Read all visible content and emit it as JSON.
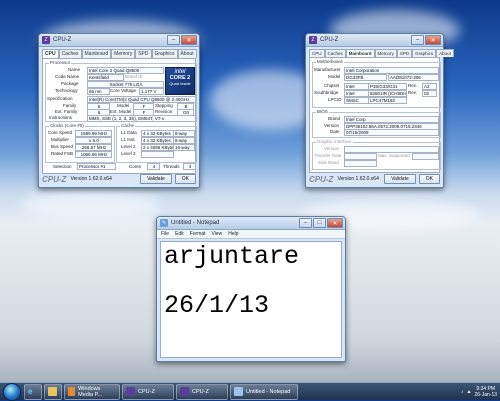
{
  "cpuz_left": {
    "title": "CPU-Z",
    "tabs": [
      "CPU",
      "Caches",
      "Mainboard",
      "Memory",
      "SPD",
      "Graphics",
      "About"
    ],
    "processor_group": "Processor",
    "name_label": "Name",
    "name": "Intel Core 2 Quad Q8600",
    "codename_label": "Code Name",
    "codename": "Kentsfield",
    "brandid_label": "Brand ID",
    "brandid": "",
    "package_label": "Package",
    "package": "Socket 775 LGA",
    "tech_label": "Technology",
    "tech": "65 nm",
    "voltage_label": "Core Voltage",
    "voltage": "1.177 V",
    "spec_label": "Specification",
    "spec": "Intel(R) Core(TM)2 Quad CPU Q8600 @ 2.40GHz",
    "family_label": "Family",
    "family": "6",
    "model_label": "Model",
    "model": "F",
    "stepping_label": "Stepping",
    "stepping": "B",
    "extfamily_label": "Ext. Family",
    "extfamily": "6",
    "extmodel_label": "Ext. Model",
    "extmodel": "F",
    "revision_label": "Revision",
    "revision": "G0",
    "instr_label": "Instructions",
    "instr": "MMX, SSE (1, 2, 3, 3S), EM64T, VT-x",
    "clocks_group": "Clocks (Core #0)",
    "corespeed_label": "Core Speed",
    "corespeed": "1599.99 MHz",
    "mult_label": "Multiplier",
    "mult": "x 6.0",
    "bus_label": "Bus Speed",
    "bus": "266.67 MHz",
    "fsb_label": "Rated FSB",
    "fsb": "1066.66 MHz",
    "cache_group": "Cache",
    "l1d_label": "L1 Data",
    "l1d": "4 x 32 KBytes",
    "l1d_way": "8-way",
    "l1i_label": "L1 Inst.",
    "l1i": "4 x 32 KBytes",
    "l1i_way": "8-way",
    "l2_label": "Level 2",
    "l2": "2 x 4096 KBytes",
    "l2_way": "16-way",
    "l3_label": "Level 3",
    "l3": "",
    "selection_label": "Selection",
    "selection": "Processor #1",
    "cores_label": "Cores",
    "cores": "4",
    "threads_label": "Threads",
    "threads": "4",
    "intel_brand": "intel",
    "intel_core": "CORE 2",
    "intel_sub": "Quad inside",
    "brand": "CPU-Z",
    "version": "Version 1.62.0.x64",
    "validate": "Validate",
    "ok": "OK"
  },
  "cpuz_right": {
    "title": "CPU-Z",
    "tabs": [
      "CPU",
      "Caches",
      "Mainboard",
      "Memory",
      "SPD",
      "Graphics",
      "About"
    ],
    "mb_group": "Motherboard",
    "manu_label": "Manufacturer",
    "manu": "Intel Corporation",
    "model_label": "Model",
    "model": "DG33FB",
    "model_rev": "AAD81072-306",
    "chipset_label": "Chipset",
    "chipset_a": "Intel",
    "chipset_b": "P35/G33/G31",
    "chipset_rev_label": "Rev.",
    "chipset_rev": "A2",
    "south_label": "Southbridge",
    "south_a": "Intel",
    "south_b": "82801IR (ICH9DH)",
    "south_rev_label": "Rev.",
    "south_rev": "02",
    "lpcio_label": "LPCIO",
    "lpcio_a": "SMSC",
    "lpcio_b": "LPC47M182",
    "bios_group": "BIOS",
    "brand_label": "Brand",
    "brand": "Intel Corp.",
    "version_label": "Version",
    "version": "DPP3510J.86A.0572.2009.0715.2346",
    "date_label": "Date",
    "date": "07/15/2009",
    "gi_group": "Graphic Interface",
    "gi_version_label": "Version",
    "gi_transfer_label": "Transfer Rate",
    "gi_max_label": "Max. Supported",
    "gi_side_label": "Side Band",
    "brand_footer": "CPU-Z",
    "version_footer": "Version 1.62.0.x64",
    "validate": "Validate",
    "ok": "OK"
  },
  "notepad": {
    "title": "Untitled - Notepad",
    "menu": [
      "File",
      "Edit",
      "Format",
      "View",
      "Help"
    ],
    "line1": "arjuntare",
    "line2": "26/1/13"
  },
  "taskbar": {
    "items": [
      "Windows Media P...",
      "CPU-Z",
      "CPU-Z",
      "Untitled - Notepad"
    ],
    "time": "9:34 PM",
    "date": "26-Jan-13"
  }
}
